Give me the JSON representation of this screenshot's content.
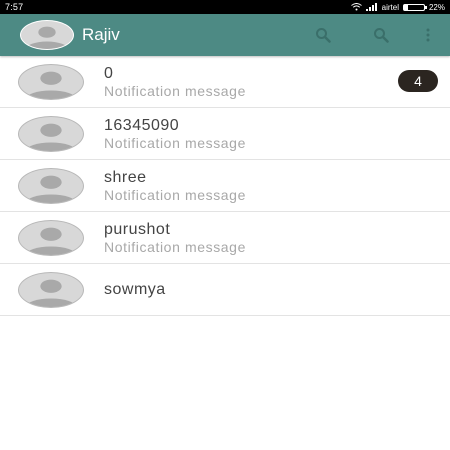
{
  "status_bar": {
    "time": "7:57",
    "carrier": "airtel",
    "battery_percent": "22%",
    "battery_level": 0.22,
    "icons": [
      "wifi-icon",
      "signal-icon",
      "battery-icon"
    ]
  },
  "app_bar": {
    "title": "Rajiv",
    "background": "#4d8a84",
    "actions": [
      "search-icon",
      "search-icon",
      "more-vert-icon"
    ]
  },
  "chats": [
    {
      "name": "0",
      "subtitle": "Notification message",
      "badge": "4"
    },
    {
      "name": "16345090",
      "subtitle": "Notification message",
      "badge": ""
    },
    {
      "name": "shree",
      "subtitle": "Notification message",
      "badge": ""
    },
    {
      "name": "purushot",
      "subtitle": "Notification message",
      "badge": ""
    },
    {
      "name": "sowmya",
      "subtitle": "",
      "badge": ""
    }
  ]
}
